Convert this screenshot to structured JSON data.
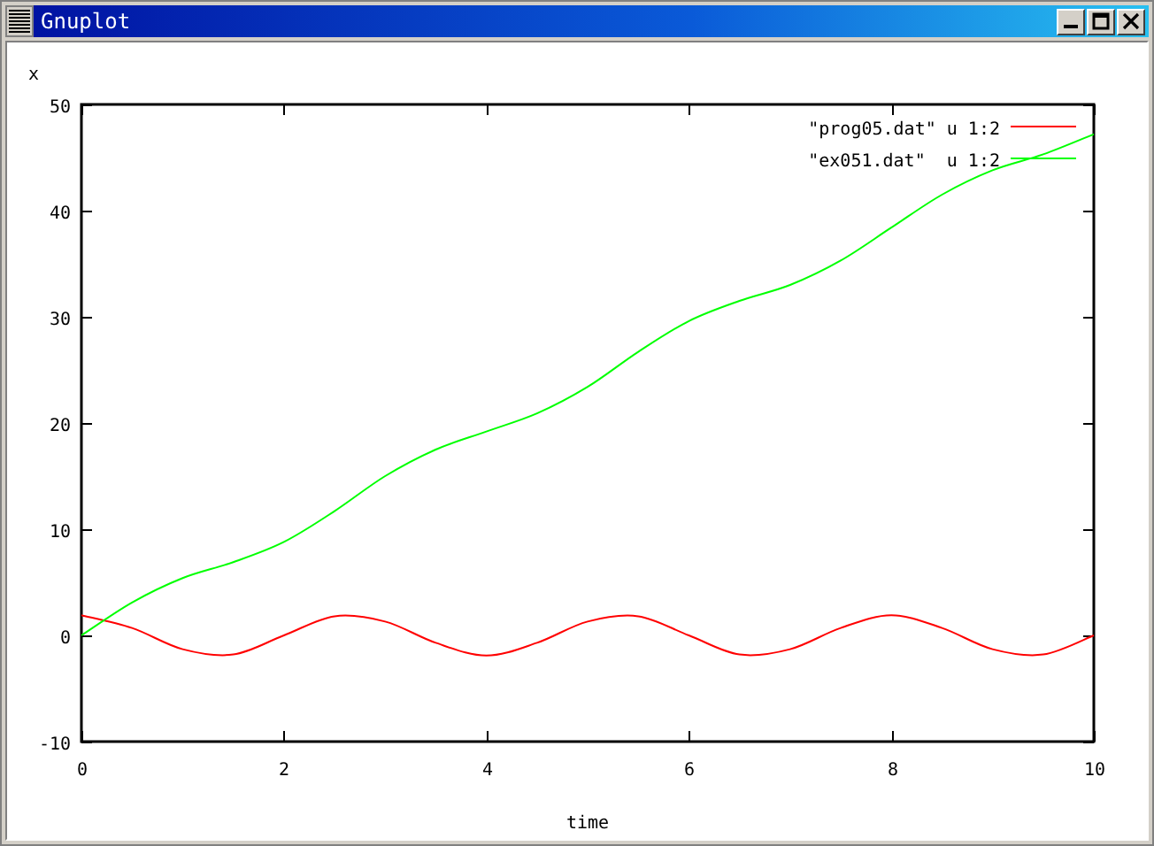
{
  "window": {
    "title": "Gnuplot"
  },
  "plot": {
    "chart_data": {
      "type": "line",
      "xlabel": "time",
      "ylabel": "x",
      "xlim": [
        0,
        10
      ],
      "ylim": [
        -10,
        50
      ],
      "legend": "top right",
      "xticks": [
        0,
        2,
        4,
        6,
        8,
        10
      ],
      "yticks": [
        -10,
        0,
        10,
        20,
        30,
        40,
        50
      ],
      "x": [
        0,
        0.5,
        1,
        1.5,
        2,
        2.5,
        3,
        3.5,
        4,
        4.5,
        5,
        5.5,
        6,
        6.5,
        7,
        7.5,
        8,
        8.5,
        9,
        9.5,
        10
      ],
      "series": [
        {
          "name": "\"prog05.dat\" u 1:2",
          "color": "#ff0000",
          "values": [
            1.9,
            0.7,
            -1.3,
            -1.8,
            0,
            1.8,
            1.3,
            -0.7,
            -1.9,
            -0.7,
            1.3,
            1.8,
            0,
            -1.8,
            -1.3,
            0.7,
            1.9,
            0.7,
            -1.3,
            -1.8,
            0
          ]
        },
        {
          "name": "\"ex051.dat\"  u 1:2",
          "color": "#00ff00",
          "values": [
            0,
            3.1,
            5.4,
            6.9,
            8.8,
            11.7,
            15,
            17.5,
            19.2,
            20.9,
            23.4,
            26.7,
            29.6,
            31.5,
            33,
            35.3,
            38.4,
            41.5,
            43.8,
            45.3,
            47.2
          ]
        }
      ]
    }
  }
}
